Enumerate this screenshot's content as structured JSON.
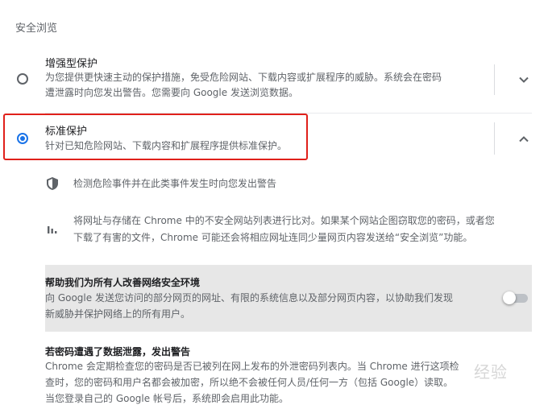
{
  "section_title": "安全浏览",
  "enhanced": {
    "title": "增强型保护",
    "desc_line1": "为您提供更快速主动的保护措施，免受危险网站、下载内容或扩展程序的威胁。系统会在密码",
    "desc_line2": "遭泄露时向您发出警告。您需要向 Google 发送浏览数据。",
    "selected": false,
    "chevron_icon": "chevron-down-icon"
  },
  "standard": {
    "title": "标准保护",
    "desc": "针对已知危险网站、下载内容和扩展程序提供标准保护。",
    "selected": true,
    "chevron_icon": "chevron-up-icon",
    "highlight_color": "#e0201a"
  },
  "details": {
    "detect_text": "检测危险事件并在此类事件发生时向您发出警告",
    "detect_icon": "shield-icon",
    "compare_line1": "将网址与存储在 Chrome 中的不安全网站列表进行比对。如果某个网站企图窃取您的密码，或者您",
    "compare_line2": "下载了有害的文件，Chrome 可能还会将相应网址连同少量网页内容发送给“安全浏览”功能。",
    "compare_icon": "bar-chart-icon"
  },
  "improve": {
    "title": "帮助我们为所有人改善网络安全环境",
    "desc_line1": "向 Google 发送您访问的部分网页的网址、有限的系统信息以及部分网页内容，以协助我们发现",
    "desc_line2": "新威胁并保护网络上的所有用户。",
    "toggle_on": false
  },
  "password": {
    "title": "若密码遭遇了数据泄露，发出警告",
    "desc_line1": "Chrome 会定期检查您的密码是否已被列在网上发布的外泄密码列表内。当 Chrome 进行这项检",
    "desc_line2": "查时，您的密码和用户名都会被加密，所以绝不会被任何人员/任何一方（包括 Google）读取。",
    "desc_line3": "当您登录自己的 Google 帐号后，系统即会启用此功能。"
  },
  "watermark": "经验",
  "colors": {
    "accent": "#1a73e8",
    "highlight": "#e0201a",
    "panel": "#e7e7e7"
  }
}
